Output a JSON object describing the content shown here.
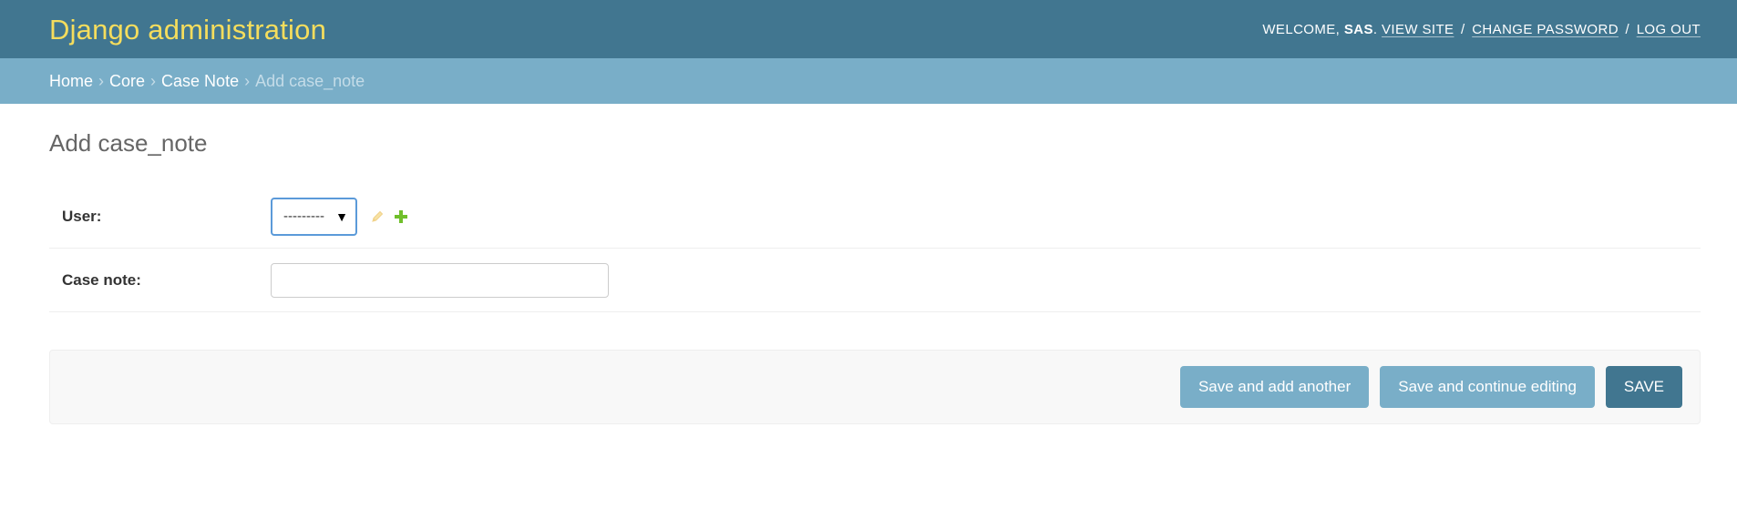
{
  "header": {
    "branding": "Django administration",
    "welcome": "WELCOME,",
    "username": "SAS",
    "view_site": "VIEW SITE",
    "change_password": "CHANGE PASSWORD",
    "log_out": "LOG OUT",
    "separator": "/"
  },
  "breadcrumbs": {
    "home": "Home",
    "app": "Core",
    "model": "Case Note",
    "current": "Add case_note",
    "separator": "›"
  },
  "page": {
    "title": "Add case_note"
  },
  "form": {
    "user_label": "User:",
    "user_selected": "---------",
    "case_note_label": "Case note:",
    "case_note_value": ""
  },
  "icons": {
    "dropdown": "caret-down-icon",
    "change_related": "pencil-icon",
    "add_related": "plus-icon"
  },
  "buttons": {
    "save_add_another": "Save and add another",
    "save_continue": "Save and continue editing",
    "save": "SAVE"
  },
  "colors": {
    "header_bg": "#417690",
    "branding": "#f5dd5d",
    "breadcrumbs_bg": "#79aec8",
    "secondary_button": "#79aec8",
    "primary_button": "#417690",
    "add_icon": "#70bf2b",
    "pencil_icon": "#efb80b"
  }
}
